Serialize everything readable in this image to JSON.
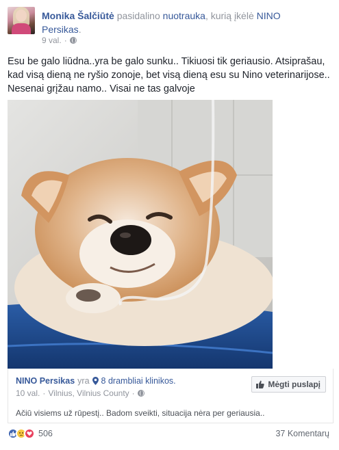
{
  "post": {
    "author": "Monika Šalčiūtė",
    "action_text": "pasidalino",
    "link_text": "nuotrauka",
    "action_text2": ", kurią įkėlė",
    "shared_from": "NINO Persikas",
    "time": "9 val.",
    "separator": "·",
    "text": "Esu be galo liūdna..yra be galo sunku.. Tikiuosi tik geriausio. Atsiprašau, kad visą dieną ne ryšio zonoje, bet visą dieną esu su Nino veterinarijose.. Nesenai grįžau namo.. Visai ne tas galvoje"
  },
  "shared": {
    "page_name": "NINO Persikas",
    "at_text": "yra",
    "place": "8 drambliai klinikos.",
    "time": "10 val.",
    "separator": "·",
    "location": "Vilnius, Vilnius County",
    "like_page_label": "Mėgti puslapį",
    "text": "Ačiū visiems už rūpestį.. Badom sveikti, situacija nėra per geriausia.."
  },
  "footer": {
    "reaction_count": "506",
    "comments_label": "37 Komentarų"
  },
  "colors": {
    "link": "#365899",
    "muted": "#90949c",
    "like_blue": "#4267b2",
    "love_red": "#e9415d",
    "sad_yellow": "#f7c843"
  },
  "icons": [
    "globe-icon",
    "location-pin-icon",
    "thumbs-up-icon",
    "like-reaction-icon",
    "sad-reaction-icon",
    "love-reaction-icon"
  ]
}
